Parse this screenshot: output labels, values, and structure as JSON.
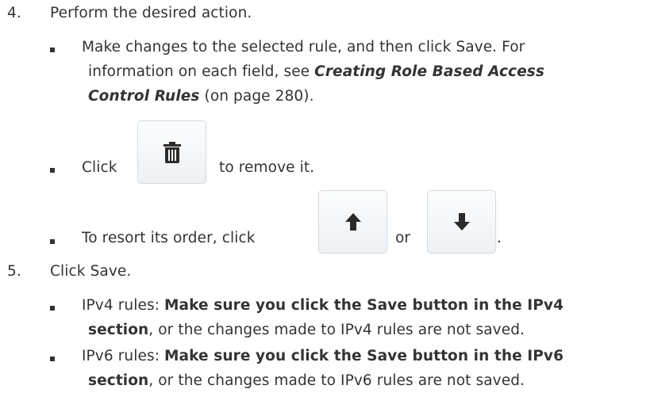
{
  "steps": [
    {
      "number": "4.",
      "text": "Perform the desired action.",
      "bullets": {
        "edit": {
          "line1": "Make changes to the selected rule, and then click Save. For",
          "line2_pre": "information on each field, see ",
          "xref_part1": "Creating Role Based Access",
          "xref_part2": "Control Rules",
          "line3_post": " (on page 280)."
        },
        "delete": {
          "pre": "Click",
          "post": "to remove it.",
          "icon": "trash-icon"
        },
        "reorder": {
          "pre": "To resort its order, click",
          "or": "or",
          "end": ".",
          "icon_up": "arrow-up-icon",
          "icon_down": "arrow-down-icon"
        }
      }
    },
    {
      "number": "5.",
      "text": "Click Save.",
      "bullets": {
        "ipv4": {
          "label": "IPv4 rules: ",
          "bold1": "Make sure you click the Save button in the IPv4",
          "bold2": "section",
          "rest": ", or the changes made to IPv4 rules are not saved."
        },
        "ipv6": {
          "label": "IPv6 rules: ",
          "bold1": "Make sure you click the Save button in the IPv6",
          "bold2": "section",
          "rest": ", or the changes made to IPv6 rules are not saved."
        }
      }
    }
  ]
}
